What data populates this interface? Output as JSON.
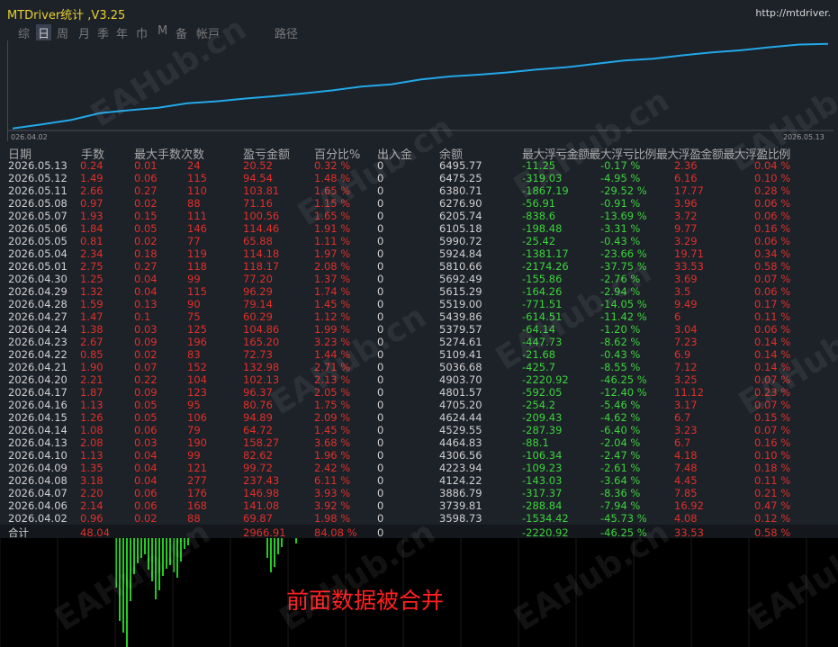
{
  "window": {
    "title": "MTDriver统计 ,V3.25",
    "url": "http://mtdriver.",
    "watermark": "EAHub.cn"
  },
  "tabs": [
    "综",
    "日",
    "周",
    "月",
    "季",
    "年",
    "巾",
    "M",
    "备",
    "帐戸",
    "路径"
  ],
  "active_tab": 1,
  "chart": {
    "start_label": "026.04.02",
    "end_label": "2026.05.13",
    "line_color": "#22a8e8"
  },
  "columns": [
    "日期",
    "手数",
    "最大手数",
    "次数",
    "盈亏金额",
    "百分比%",
    "出入金",
    "余额",
    "最大浮亏金额",
    "最大浮亏比例",
    "最大浮盈金额",
    "最大浮盈比例"
  ],
  "rows": [
    [
      "2026.05.13",
      "0.24",
      "0.01",
      "24",
      "20.52",
      "0.32 %",
      "0",
      "6495.77",
      "-11.25",
      "-0.17 %",
      "2.36",
      "0.04 %"
    ],
    [
      "2026.05.12",
      "1.49",
      "0.06",
      "115",
      "94.54",
      "1.48 %",
      "0",
      "6475.25",
      "-319.03",
      "-4.95 %",
      "6.16",
      "0.10 %"
    ],
    [
      "2026.05.11",
      "2.66",
      "0.27",
      "110",
      "103.81",
      "1.65 %",
      "0",
      "6380.71",
      "-1867.19",
      "-29.52 %",
      "17.77",
      "0.28 %"
    ],
    [
      "2026.05.08",
      "0.97",
      "0.02",
      "88",
      "71.16",
      "1.15 %",
      "0",
      "6276.90",
      "-56.91",
      "-0.91 %",
      "3.96",
      "0.06 %"
    ],
    [
      "2026.05.07",
      "1.93",
      "0.15",
      "111",
      "100.56",
      "1.65 %",
      "0",
      "6205.74",
      "-838.6",
      "-13.69 %",
      "3.72",
      "0.06 %"
    ],
    [
      "2026.05.06",
      "1.84",
      "0.05",
      "146",
      "114.46",
      "1.91 %",
      "0",
      "6105.18",
      "-198.48",
      "-3.31 %",
      "9.77",
      "0.16 %"
    ],
    [
      "2026.05.05",
      "0.81",
      "0.02",
      "77",
      "65.88",
      "1.11 %",
      "0",
      "5990.72",
      "-25.42",
      "-0.43 %",
      "3.29",
      "0.06 %"
    ],
    [
      "2026.05.04",
      "2.34",
      "0.18",
      "119",
      "114.18",
      "1.97 %",
      "0",
      "5924.84",
      "-1381.17",
      "-23.66 %",
      "19.71",
      "0.34 %"
    ],
    [
      "2026.05.01",
      "2.75",
      "0.27",
      "118",
      "118.17",
      "2.08 %",
      "0",
      "5810.66",
      "-2174.26",
      "-37.75 %",
      "33.53",
      "0.58 %"
    ],
    [
      "2026.04.30",
      "1.25",
      "0.04",
      "99",
      "77.20",
      "1.37 %",
      "0",
      "5692.49",
      "-155.86",
      "-2.76 %",
      "3.69",
      "0.07 %"
    ],
    [
      "2026.04.29",
      "1.32",
      "0.04",
      "115",
      "96.29",
      "1.74 %",
      "0",
      "5615.29",
      "-164.26",
      "-2.94 %",
      "3.5",
      "0.06 %"
    ],
    [
      "2026.04.28",
      "1.59",
      "0.13",
      "90",
      "79.14",
      "1.45 %",
      "0",
      "5519.00",
      "-771.51",
      "-14.05 %",
      "9.49",
      "0.17 %"
    ],
    [
      "2026.04.27",
      "1.47",
      "0.1",
      "75",
      "60.29",
      "1.12 %",
      "0",
      "5439.86",
      "-614.51",
      "-11.42 %",
      "6",
      "0.11 %"
    ],
    [
      "2026.04.24",
      "1.38",
      "0.03",
      "125",
      "104.86",
      "1.99 %",
      "0",
      "5379.57",
      "-64.14",
      "-1.20 %",
      "3.04",
      "0.06 %"
    ],
    [
      "2026.04.23",
      "2.67",
      "0.09",
      "196",
      "165.20",
      "3.23 %",
      "0",
      "5274.61",
      "-447.73",
      "-8.62 %",
      "7.23",
      "0.14 %"
    ],
    [
      "2026.04.22",
      "0.85",
      "0.02",
      "83",
      "72.73",
      "1.44 %",
      "0",
      "5109.41",
      "-21.68",
      "-0.43 %",
      "6.9",
      "0.14 %"
    ],
    [
      "2026.04.21",
      "1.90",
      "0.07",
      "152",
      "132.98",
      "2.71 %",
      "0",
      "5036.68",
      "-425.7",
      "-8.55 %",
      "7.12",
      "0.14 %"
    ],
    [
      "2026.04.20",
      "2.21",
      "0.22",
      "104",
      "102.13",
      "2.13 %",
      "0",
      "4903.70",
      "-2220.92",
      "-46.25 %",
      "3.25",
      "0.07 %"
    ],
    [
      "2026.04.17",
      "1.87",
      "0.09",
      "123",
      "96.37",
      "2.05 %",
      "0",
      "4801.57",
      "-592.05",
      "-12.40 %",
      "11.12",
      "0.23 %"
    ],
    [
      "2026.04.16",
      "1.13",
      "0.05",
      "95",
      "80.76",
      "1.75 %",
      "0",
      "4705.20",
      "-254.2",
      "-5.46 %",
      "3.17",
      "0.07 %"
    ],
    [
      "2026.04.15",
      "1.26",
      "0.05",
      "106",
      "94.89",
      "2.09 %",
      "0",
      "4624.44",
      "-209.43",
      "-4.62 %",
      "6.7",
      "0.15 %"
    ],
    [
      "2026.04.14",
      "1.08",
      "0.06",
      "79",
      "64.72",
      "1.45 %",
      "0",
      "4529.55",
      "-287.39",
      "-6.40 %",
      "3.23",
      "0.07 %"
    ],
    [
      "2026.04.13",
      "2.08",
      "0.03",
      "190",
      "158.27",
      "3.68 %",
      "0",
      "4464.83",
      "-88.1",
      "-2.04 %",
      "6.7",
      "0.16 %"
    ],
    [
      "2026.04.10",
      "1.13",
      "0.04",
      "99",
      "82.62",
      "1.96 %",
      "0",
      "4306.56",
      "-106.34",
      "-2.47 %",
      "4.18",
      "0.10 %"
    ],
    [
      "2026.04.09",
      "1.35",
      "0.04",
      "121",
      "99.72",
      "2.42 %",
      "0",
      "4223.94",
      "-109.23",
      "-2.61 %",
      "7.48",
      "0.18 %"
    ],
    [
      "2026.04.08",
      "3.18",
      "0.04",
      "277",
      "237.43",
      "6.11 %",
      "0",
      "4124.22",
      "-143.03",
      "-3.64 %",
      "4.45",
      "0.11 %"
    ],
    [
      "2026.04.07",
      "2.20",
      "0.06",
      "176",
      "146.98",
      "3.93 %",
      "0",
      "3886.79",
      "-317.37",
      "-8.36 %",
      "7.85",
      "0.21 %"
    ],
    [
      "2026.04.06",
      "2.14",
      "0.06",
      "168",
      "141.08",
      "3.92 %",
      "0",
      "3739.81",
      "-288.84",
      "-7.94 %",
      "16.92",
      "0.47 %"
    ],
    [
      "2026.04.02",
      "0.96",
      "0.02",
      "88",
      "69.87",
      "1.98 %",
      "0",
      "3598.73",
      "-1534.42",
      "-45.73 %",
      "4.08",
      "0.12 %"
    ]
  ],
  "total": [
    "合计",
    "48.04",
    "",
    "",
    "2966.91",
    "84.08 %",
    "0",
    "",
    "-2220.92",
    "-46.25 %",
    "33.53",
    "0.58 %"
  ],
  "bottom_label": "前面数据被合并",
  "colors": {
    "positive": "#e0302a",
    "negative": "#3cd43c",
    "neutral": "#d0d0d0",
    "panel": "#1d2128"
  }
}
